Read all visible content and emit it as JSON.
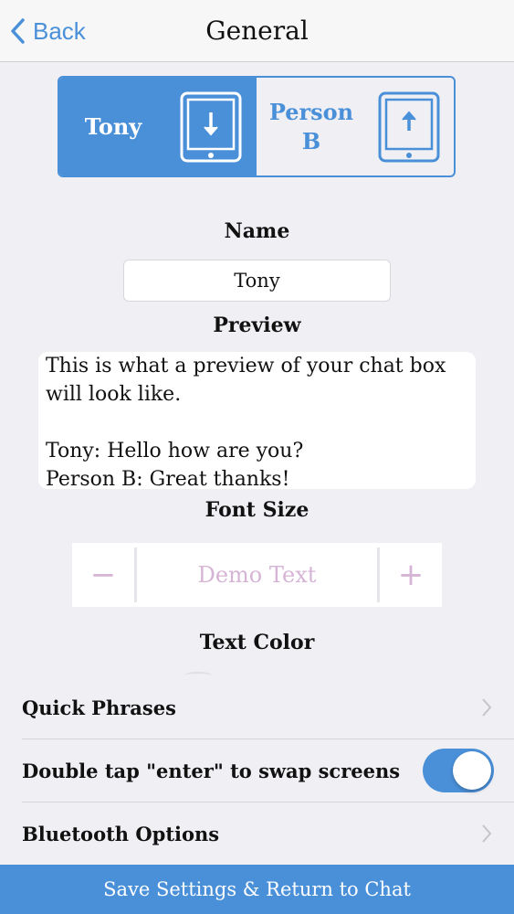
{
  "nav": {
    "back_label": "Back",
    "title": "General"
  },
  "selector": {
    "options": [
      {
        "label": "Tony",
        "active": true,
        "icon": "tablet-download-icon"
      },
      {
        "label": "Person B",
        "active": false,
        "icon": "tablet-upload-icon"
      }
    ]
  },
  "name": {
    "label": "Name",
    "value": "Tony"
  },
  "preview": {
    "label": "Preview",
    "text": "This is what a preview of your chat box will look like.\n\nTony: Hello how are you?\nPerson B: Great thanks!"
  },
  "font_size": {
    "label": "Font Size",
    "minus": "−",
    "plus": "+",
    "demo_text": "Demo Text"
  },
  "text_color": {
    "label": "Text Color"
  },
  "rows": {
    "quick_phrases": "Quick Phrases",
    "double_tap": "Double tap \"enter\" to swap screens",
    "double_tap_on": true,
    "bluetooth": "Bluetooth Options"
  },
  "save_button": "Save Settings & Return to Chat",
  "colors": {
    "accent": "#4a90d9",
    "background": "#efeff4",
    "demo_text": "#d6b4d6"
  }
}
